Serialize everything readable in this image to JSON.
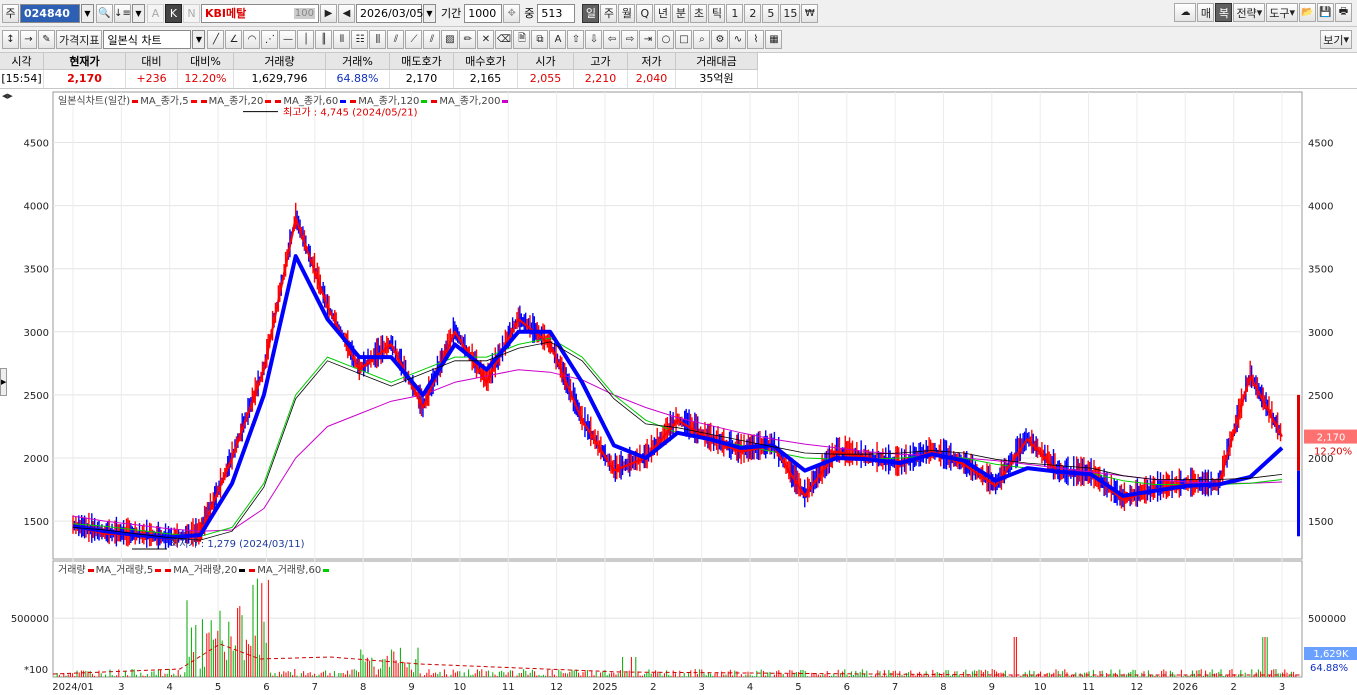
{
  "toolbar": {
    "market_label": "주",
    "code": "024840",
    "k_label": "K",
    "n_label": "N",
    "a_label": "A",
    "name": "KBI메탈",
    "name_suffix": "100",
    "date": "2026/03/05",
    "period_label": "기간",
    "period_value": "1000",
    "mid_label": "중",
    "mid_value": "513",
    "period_buttons": [
      "일",
      "주",
      "월",
      "Q",
      "년",
      "분",
      "초",
      "틱",
      "1",
      "2",
      "5",
      "15"
    ],
    "right_buttons": [
      "매",
      "복",
      "전략",
      "도구"
    ],
    "indicator_label": "가격지표",
    "chart_type_label": "일본식 차트",
    "view_label": "보기"
  },
  "quote": {
    "columns": [
      {
        "header": "시각",
        "value": "[15:54]",
        "color": "#000000"
      },
      {
        "header": "현재가",
        "value": "2,170",
        "color": "#e00000"
      },
      {
        "header": "대비",
        "value": "+236",
        "color": "#e00000"
      },
      {
        "header": "대비%",
        "value": "12.20%",
        "color": "#e00000"
      },
      {
        "header": "거래량",
        "value": "1,629,796",
        "color": "#000000"
      },
      {
        "header": "거래%",
        "value": "64.88%",
        "color": "#1030c0"
      },
      {
        "header": "매도호가",
        "value": "2,170",
        "color": "#000000"
      },
      {
        "header": "매수호가",
        "value": "2,165",
        "color": "#000000"
      },
      {
        "header": "시가",
        "value": "2,055",
        "color": "#e00000"
      },
      {
        "header": "고가",
        "value": "2,210",
        "color": "#e00000"
      },
      {
        "header": "저가",
        "value": "2,040",
        "color": "#e00000"
      },
      {
        "header": "거래대금",
        "value": "35억원",
        "color": "#000000"
      }
    ]
  },
  "legend": {
    "title": "일본식차트(일간)",
    "items": [
      {
        "label": "MA_종가,5",
        "color": "#ff0000"
      },
      {
        "label": "MA_종가,20",
        "color": "#ff0000"
      },
      {
        "label": "MA_종가,60",
        "color": "#0000ff"
      },
      {
        "label": "MA_종가,120",
        "color": "#00cc00"
      },
      {
        "label": "MA_종가,200",
        "color": "#cc00cc"
      }
    ]
  },
  "volume_legend": {
    "title": "거래량",
    "items": [
      {
        "label": "MA_거래량,5",
        "color": "#ff0000"
      },
      {
        "label": "MA_거래량,20",
        "color": "#000000"
      },
      {
        "label": "MA_거래량,60",
        "color": "#00cc00"
      }
    ]
  },
  "chart_data": {
    "type": "line",
    "title": "일본식차트(일간)",
    "x": [
      "2024/01",
      "3",
      "4",
      "5",
      "6",
      "7",
      "8",
      "9",
      "10",
      "11",
      "12",
      "2025",
      "2",
      "3",
      "4",
      "5",
      "6",
      "7",
      "8",
      "9",
      "10",
      "11",
      "12",
      "2026",
      "2",
      "3"
    ],
    "ylim": [
      1200,
      4900
    ],
    "yticks": [
      1500,
      2000,
      2500,
      3000,
      3500,
      4000,
      4500
    ],
    "series": [
      {
        "name": "MA_종가,5",
        "color": "#ff0000",
        "values": [
          1460,
          1400,
          1390,
          1360,
          1400,
          2000,
          2700,
          3900,
          3200,
          2700,
          2900,
          2400,
          3000,
          2600,
          3100,
          2900,
          2300,
          1900,
          2000,
          2300,
          2150,
          2050,
          2100,
          1700,
          2050,
          2000,
          1950,
          2050,
          1950,
          1780,
          2150,
          1880,
          1870,
          1670,
          1750,
          1790,
          1780,
          2650,
          2170
        ]
      },
      {
        "name": "MA_종가,20",
        "color": "#0000ff",
        "values": [
          1460,
          1420,
          1390,
          1370,
          1390,
          1800,
          2500,
          3600,
          3100,
          2800,
          2800,
          2500,
          2900,
          2700,
          3000,
          3000,
          2600,
          2100,
          2000,
          2200,
          2150,
          2080,
          2100,
          1900,
          2000,
          1990,
          1960,
          2030,
          1980,
          1820,
          1920,
          1890,
          1870,
          1700,
          1740,
          1780,
          1790,
          1850,
          2080
        ]
      },
      {
        "name": "MA_종가,120",
        "color": "#00cc00",
        "values": [
          1480,
          1460,
          1430,
          1400,
          1380,
          1450,
          1800,
          2500,
          2800,
          2700,
          2600,
          2700,
          2800,
          2800,
          2900,
          2950,
          2800,
          2500,
          2300,
          2200,
          2150,
          2100,
          2050,
          2000,
          1990,
          1990,
          2000,
          2020,
          2000,
          1950,
          1920,
          1900,
          1880,
          1820,
          1790,
          1790,
          1790,
          1800,
          1830
        ]
      },
      {
        "name": "MA_종가,200",
        "color": "#cc00cc",
        "values": [
          1540,
          1500,
          1470,
          1440,
          1420,
          1430,
          1600,
          2000,
          2250,
          2350,
          2450,
          2500,
          2600,
          2650,
          2700,
          2680,
          2620,
          2500,
          2400,
          2320,
          2260,
          2200,
          2150,
          2110,
          2080,
          2050,
          2030,
          2020,
          2000,
          1980,
          1950,
          1920,
          1890,
          1860,
          1830,
          1810,
          1800,
          1800,
          1810
        ]
      },
      {
        "name": "MA_거래량,5",
        "color": "#ff0000",
        "values": []
      },
      {
        "name": "MA_거래량,20",
        "color": "#000000",
        "values": []
      },
      {
        "name": "MA_거래량,60",
        "color": "#00cc00",
        "values": []
      }
    ],
    "volume_ticks": [
      500000
    ],
    "volume_marker": "*100",
    "annotations": [
      {
        "label": "최고가 : 4,745 (2024/05/21)",
        "value": 4745,
        "color": "#e00000"
      },
      {
        "label": "최저가 : 1,279 (2024/03/11)",
        "value": 1279,
        "color": "#1a3a9a"
      }
    ],
    "current_price": {
      "value": 2170,
      "label": "2,170",
      "change": "12.20%"
    },
    "current_volume": {
      "label": "1,629K",
      "pct": "64.88%"
    },
    "grid": true
  }
}
